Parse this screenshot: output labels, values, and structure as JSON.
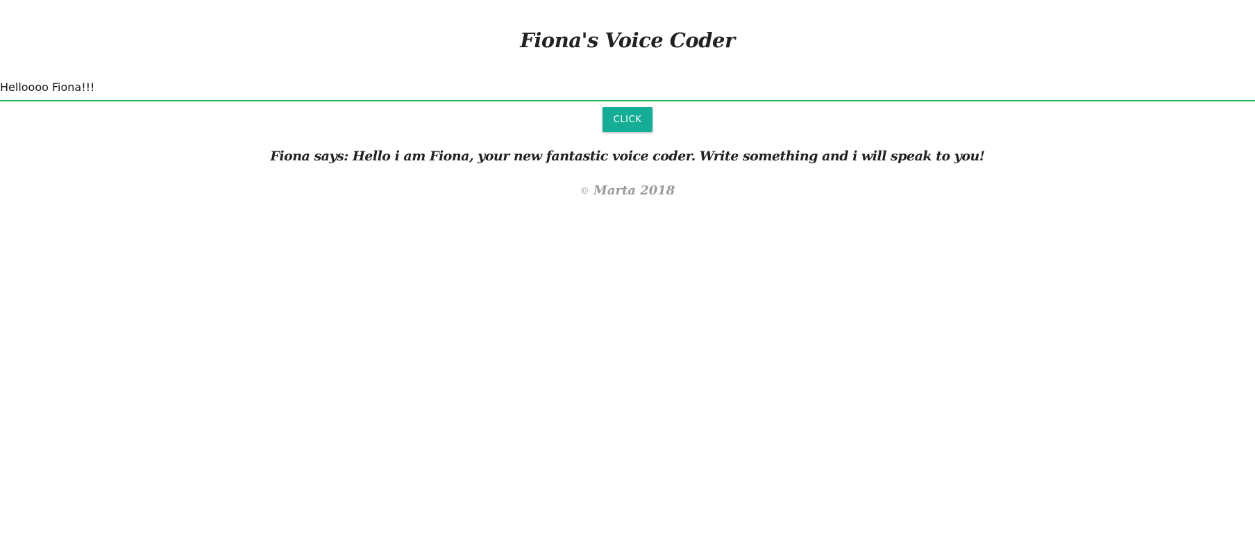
{
  "header": {
    "title": "Fiona's Voice Coder"
  },
  "input": {
    "value": "Helloooo Fiona!!!",
    "accent_color": "#1fb45a"
  },
  "button": {
    "label": "CLICK",
    "color": "#15ad96"
  },
  "output": {
    "message": "Fiona says: Hello i am Fiona, your new fantastic voice coder. Write something and i will speak to you!"
  },
  "footer": {
    "copyright_symbol": "©",
    "credit": "Marta 2018"
  }
}
